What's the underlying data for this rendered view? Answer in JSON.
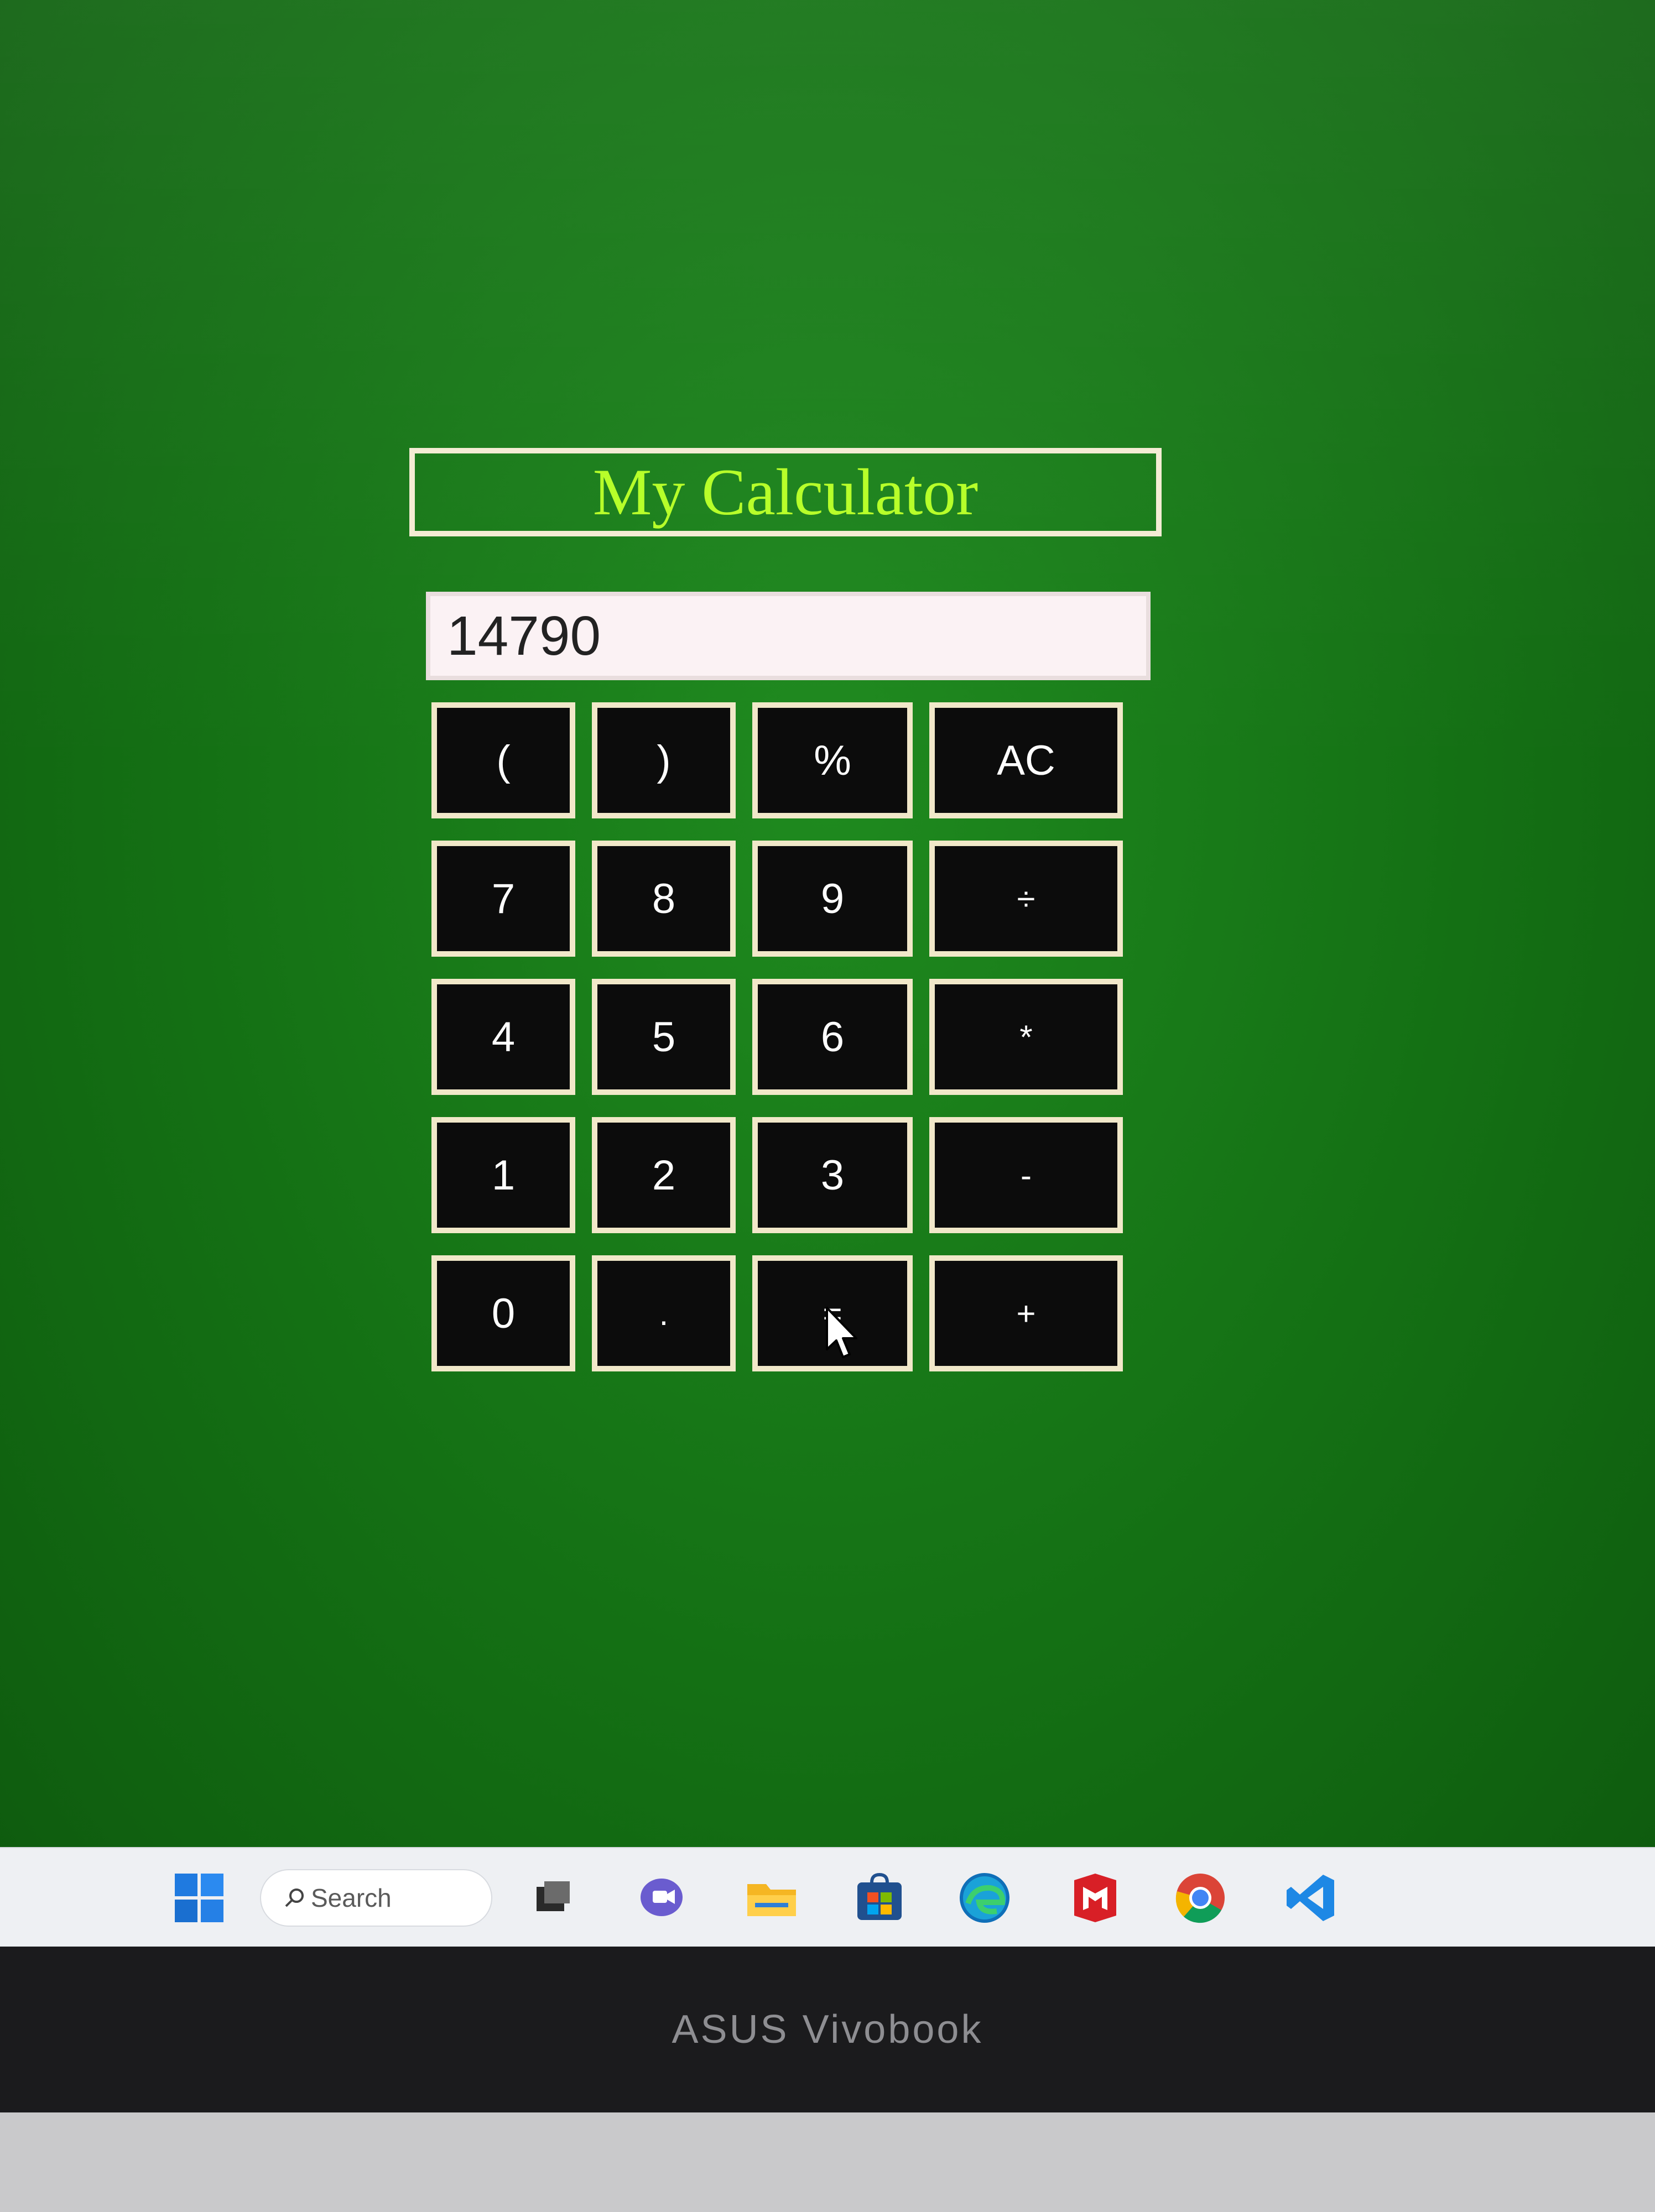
{
  "calculator": {
    "title": "My Calculator",
    "display_value": "14790",
    "keys": [
      {
        "label": "(",
        "name": "open-paren-button"
      },
      {
        "label": ")",
        "name": "close-paren-button"
      },
      {
        "label": "%",
        "name": "percent-button"
      },
      {
        "label": "AC",
        "name": "all-clear-button"
      },
      {
        "label": "7",
        "name": "digit-7-button"
      },
      {
        "label": "8",
        "name": "digit-8-button"
      },
      {
        "label": "9",
        "name": "digit-9-button"
      },
      {
        "label": "÷",
        "name": "divide-button"
      },
      {
        "label": "4",
        "name": "digit-4-button"
      },
      {
        "label": "5",
        "name": "digit-5-button"
      },
      {
        "label": "6",
        "name": "digit-6-button"
      },
      {
        "label": "*",
        "name": "multiply-button"
      },
      {
        "label": "1",
        "name": "digit-1-button"
      },
      {
        "label": "2",
        "name": "digit-2-button"
      },
      {
        "label": "3",
        "name": "digit-3-button"
      },
      {
        "label": "-",
        "name": "subtract-button"
      },
      {
        "label": "0",
        "name": "digit-0-button"
      },
      {
        "label": ".",
        "name": "decimal-button"
      },
      {
        "label": "=",
        "name": "equals-button"
      },
      {
        "label": "+",
        "name": "add-button"
      }
    ]
  },
  "taskbar": {
    "search_label": "Search",
    "icons": [
      "windows-start-icon",
      "search-icon",
      "task-view-icon",
      "chat-icon",
      "file-explorer-icon",
      "store-icon",
      "edge-icon",
      "mcafee-icon",
      "chrome-icon",
      "vscode-icon"
    ]
  },
  "device": {
    "brand": "ASUS Vivobook"
  },
  "colors": {
    "background": "#147014",
    "title": "#b7ff2a",
    "key_bg": "#0c0c0c",
    "key_border": "#f1e8c9",
    "display_bg": "#fbf2f4"
  }
}
